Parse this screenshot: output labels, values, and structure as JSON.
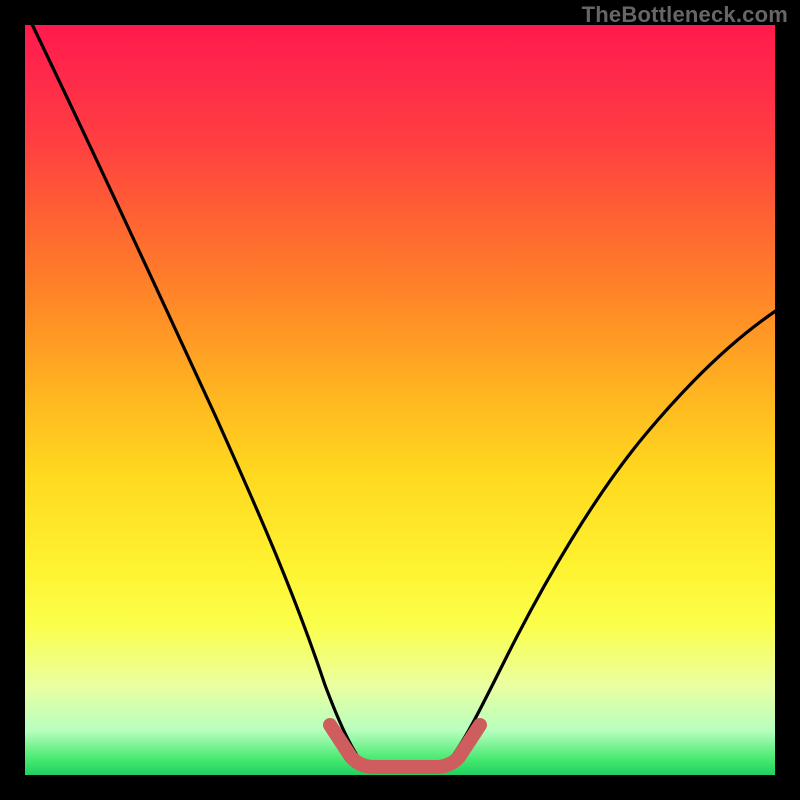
{
  "watermark": "TheBottleneck.com",
  "colors": {
    "frame": "#000000",
    "watermark_text": "#666666",
    "curve_stroke": "#000000",
    "highlight_stroke": "#cf5d5d",
    "gradient_stops": [
      "#ff1a4d",
      "#ff2a4a",
      "#ff4040",
      "#ff6a30",
      "#ff9325",
      "#ffb820",
      "#ffd91f",
      "#fff230",
      "#fbff4a",
      "#eaffa0",
      "#b8ffbf",
      "#45e86f",
      "#20d060"
    ]
  },
  "chart_data": {
    "type": "line",
    "title": "",
    "xlabel": "",
    "ylabel": "",
    "xlim": [
      0,
      100
    ],
    "ylim": [
      0,
      100
    ],
    "series": [
      {
        "name": "left-curve",
        "x": [
          0,
          5,
          10,
          15,
          20,
          25,
          30,
          35,
          38,
          40,
          42,
          44
        ],
        "values": [
          100,
          88,
          76,
          64,
          52,
          40,
          29,
          18,
          11,
          7,
          4,
          2
        ]
      },
      {
        "name": "valley-floor",
        "x": [
          44,
          46,
          48,
          50,
          52,
          54,
          56
        ],
        "values": [
          2,
          1,
          1,
          1,
          1,
          1,
          2
        ]
      },
      {
        "name": "right-curve",
        "x": [
          56,
          60,
          65,
          70,
          75,
          80,
          85,
          90,
          95,
          100
        ],
        "values": [
          2,
          6,
          13,
          21,
          29,
          37,
          44,
          51,
          57,
          62
        ]
      }
    ],
    "highlight": {
      "name": "valley-highlight",
      "x": [
        40,
        43,
        46,
        50,
        54,
        57,
        60
      ],
      "values": [
        7,
        3,
        2,
        2,
        2,
        3,
        7
      ]
    }
  }
}
